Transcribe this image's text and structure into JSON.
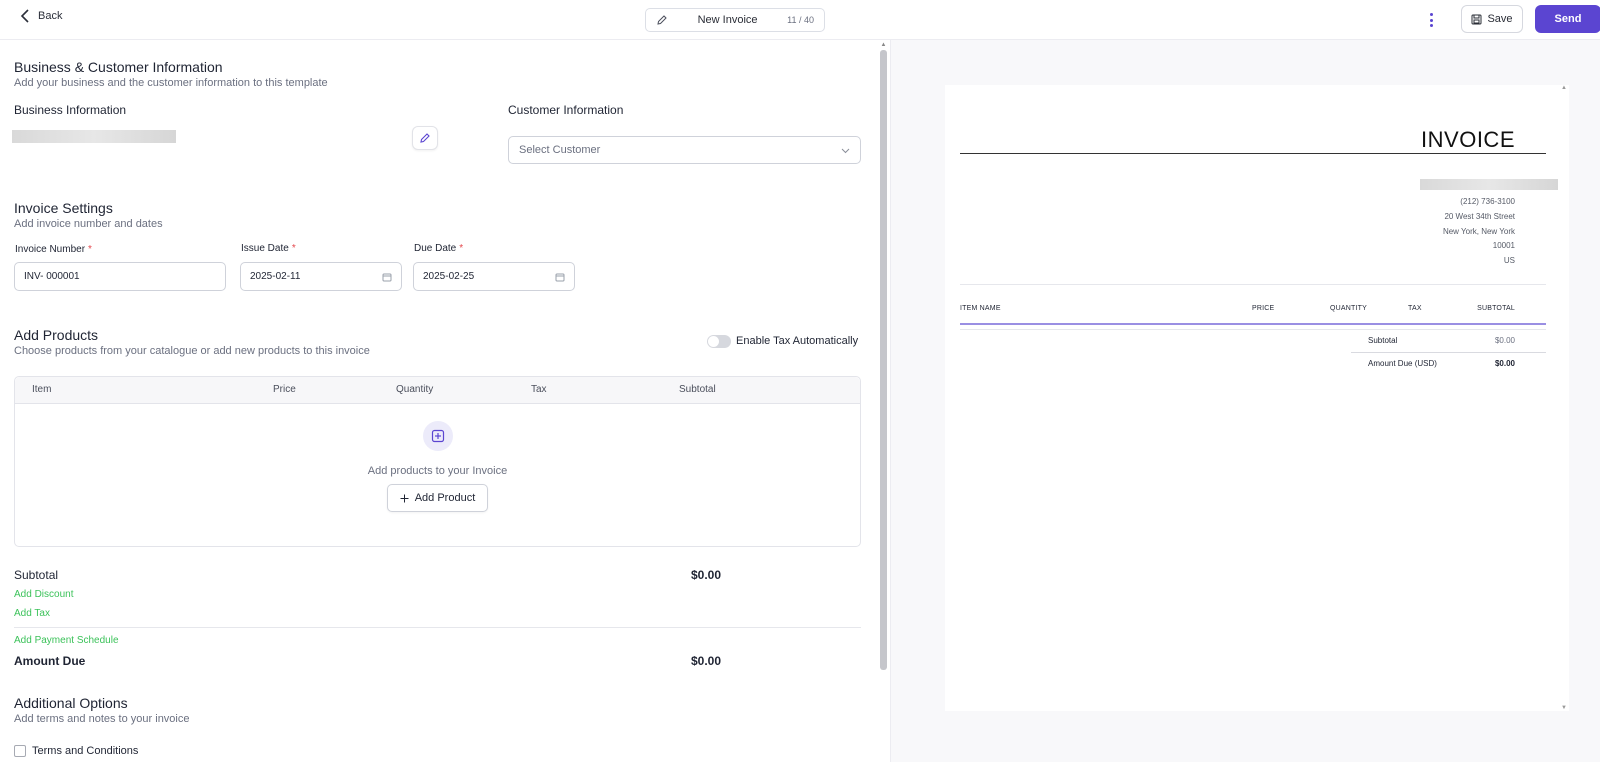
{
  "header": {
    "back_label": "Back",
    "doc_title": "New Invoice",
    "char_count": "11 / 40",
    "save_label": "Save",
    "send_label": "Send"
  },
  "business_customer": {
    "title": "Business & Customer Information",
    "subtitle": "Add your business and the customer information to this template",
    "business_label": "Business Information",
    "customer_label": "Customer Information",
    "customer_placeholder": "Select Customer"
  },
  "invoice_settings": {
    "title": "Invoice Settings",
    "subtitle": "Add invoice number and dates",
    "number_label": "Invoice Number",
    "number_value": "INV- 000001",
    "issue_label": "Issue Date",
    "issue_value": "2025-02-11",
    "due_label": "Due Date",
    "due_value": "2025-02-25",
    "required_mark": "*"
  },
  "products": {
    "title": "Add Products",
    "subtitle": "Choose products from your catalogue or add new products to this invoice",
    "tax_toggle_label": "Enable Tax Automatically",
    "columns": [
      "Item",
      "Price",
      "Quantity",
      "Tax",
      "Subtotal"
    ],
    "empty_text": "Add products to your Invoice",
    "add_button": "Add Product"
  },
  "totals": {
    "subtotal_label": "Subtotal",
    "subtotal_value": "$0.00",
    "add_discount": "Add Discount",
    "add_tax": "Add Tax",
    "add_payment_schedule": "Add Payment Schedule",
    "amount_due_label": "Amount Due",
    "amount_due_value": "$0.00"
  },
  "additional": {
    "title": "Additional Options",
    "subtitle": "Add terms and notes to your invoice",
    "terms_label": "Terms and Conditions"
  },
  "preview": {
    "heading": "INVOICE",
    "address_lines": [
      "(212) 736-3100",
      "20 West 34th Street",
      "New York, New York",
      "10001",
      "US"
    ],
    "columns": [
      "ITEM NAME",
      "PRICE",
      "QUANTITY",
      "TAX",
      "SUBTOTAL"
    ],
    "subtotal_label": "Subtotal",
    "subtotal_value": "$0.00",
    "amount_due_label": "Amount Due (USD)",
    "amount_due_value": "$0.00"
  },
  "colors": {
    "accent": "#5b45d1",
    "link_green": "#3cc25a",
    "required": "#e5484d"
  }
}
